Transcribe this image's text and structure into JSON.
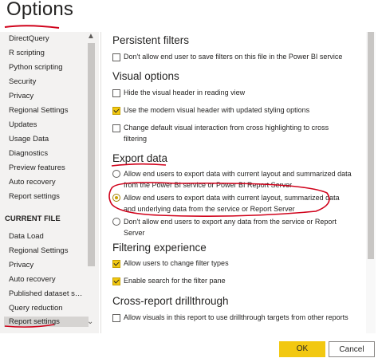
{
  "dialog": {
    "title": "Options"
  },
  "sidebar": {
    "items_top": [
      "DirectQuery",
      "R scripting",
      "Python scripting",
      "Security",
      "Privacy",
      "Regional Settings",
      "Updates",
      "Usage Data",
      "Diagnostics",
      "Preview features",
      "Auto recovery",
      "Report settings"
    ],
    "current_file_title": "CURRENT FILE",
    "items_file": [
      "Data Load",
      "Regional Settings",
      "Privacy",
      "Auto recovery",
      "Published dataset set...",
      "Query reduction",
      "Report settings"
    ]
  },
  "main": {
    "persistent_filters": {
      "heading": "Persistent filters",
      "opt1": "Don't allow end user to save filters on this file in the Power BI service"
    },
    "visual_options": {
      "heading": "Visual options",
      "opt1": "Hide the visual header in reading view",
      "opt2": "Use the modern visual header with updated styling options",
      "opt3": "Change default visual interaction from cross highlighting to cross filtering"
    },
    "export_data": {
      "heading": "Export data",
      "opt1": "Allow end users to export data with current layout and summarized data from the Power BI service or Power BI Report Server",
      "opt2": "Allow end users to export data with current layout, summarized data and underlying data from the service or Report Server",
      "opt3": "Don't allow end users to export any data from the service or Report Server"
    },
    "filtering_experience": {
      "heading": "Filtering experience",
      "opt1": "Allow users to change filter types",
      "opt2": "Enable search for the filter pane"
    },
    "cross_report": {
      "heading": "Cross-report drillthrough",
      "opt1": "Allow visuals in this report to use drillthrough targets from other reports"
    }
  },
  "footer": {
    "ok": "OK",
    "cancel": "Cancel"
  },
  "colors": {
    "accent": "#f2c811",
    "annotation": "#d0021b",
    "sidebar_bg": "#f3f2f1"
  }
}
